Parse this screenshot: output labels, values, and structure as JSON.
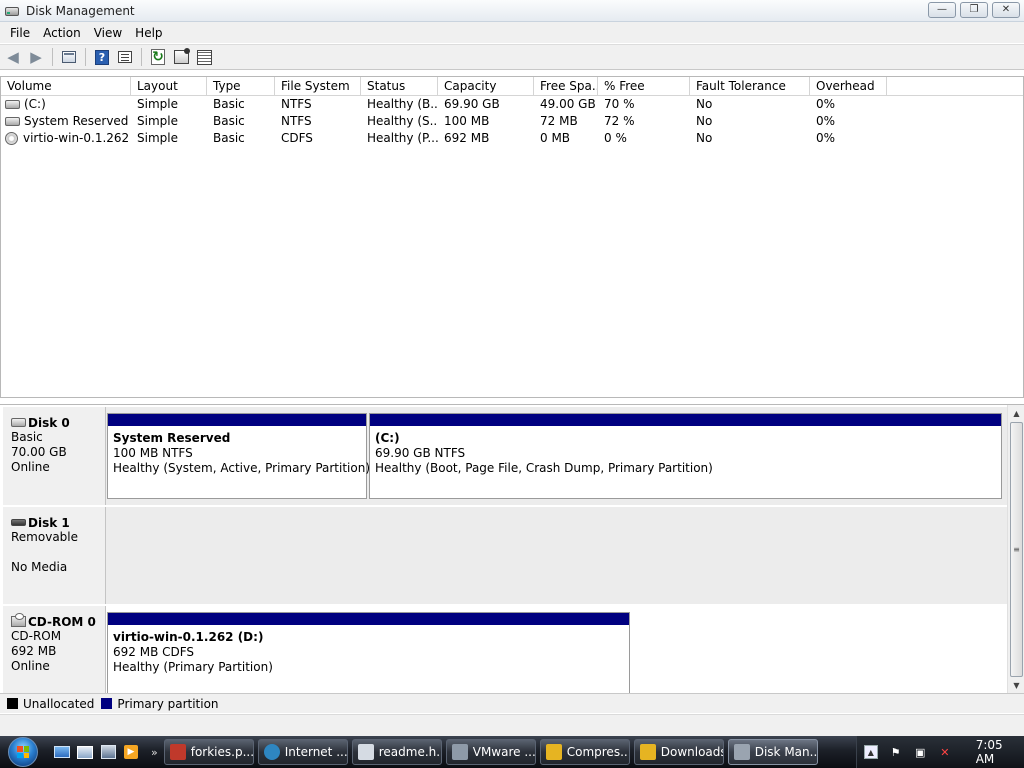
{
  "window": {
    "title": "Disk Management",
    "controls": {
      "minimize": "—",
      "restore": "❐",
      "close": "✕"
    }
  },
  "menu": [
    "File",
    "Action",
    "View",
    "Help"
  ],
  "toolbar": {
    "icons": [
      "back-icon",
      "forward-icon",
      "console-tree-icon",
      "help-icon",
      "list-view-icon",
      "refresh-icon",
      "properties-icon",
      "rescan-disks-icon"
    ],
    "help_glyph": "?"
  },
  "volume_list": {
    "columns": [
      "Volume",
      "Layout",
      "Type",
      "File System",
      "Status",
      "Capacity",
      "Free Spa...",
      "% Free",
      "Fault Tolerance",
      "Overhead"
    ],
    "rows": [
      {
        "volume": "(C:)",
        "layout": "Simple",
        "type": "Basic",
        "fs": "NTFS",
        "status": "Healthy (B...",
        "capacity": "69.90 GB",
        "free": "49.00 GB",
        "pct": "70 %",
        "fault": "No",
        "overhead": "0%",
        "icon": "hard-drive-icon"
      },
      {
        "volume": "System Reserved",
        "layout": "Simple",
        "type": "Basic",
        "fs": "NTFS",
        "status": "Healthy (S...",
        "capacity": "100 MB",
        "free": "72 MB",
        "pct": "72 %",
        "fault": "No",
        "overhead": "0%",
        "icon": "hard-drive-icon"
      },
      {
        "volume": "virtio-win-0.1.262 ...",
        "layout": "Simple",
        "type": "Basic",
        "fs": "CDFS",
        "status": "Healthy (P...",
        "capacity": "692 MB",
        "free": "0 MB",
        "pct": "0 %",
        "fault": "No",
        "overhead": "0%",
        "icon": "cd-drive-icon"
      }
    ]
  },
  "disks": [
    {
      "name": "Disk 0",
      "line1": "Basic",
      "line2": "70.00 GB",
      "line3": "Online",
      "partitions": [
        {
          "title": "System Reserved",
          "size": "100 MB NTFS",
          "status": "Healthy (System, Active, Primary Partition)"
        },
        {
          "title": "(C:)",
          "size": "69.90 GB NTFS",
          "status": "Healthy (Boot, Page File, Crash Dump, Primary Partition)"
        }
      ]
    },
    {
      "name": "Disk 1",
      "line1": "Removable",
      "line2": "",
      "line3": "No Media",
      "partitions": []
    },
    {
      "name": "CD-ROM 0",
      "line1": "CD-ROM",
      "line2": "692 MB",
      "line3": "Online",
      "partitions": [
        {
          "title": "virtio-win-0.1.262  (D:)",
          "size": "692 MB CDFS",
          "status": "Healthy (Primary Partition)"
        }
      ]
    }
  ],
  "legend": [
    {
      "label": "Unallocated",
      "color": "#000000"
    },
    {
      "label": "Primary partition",
      "color": "#000080"
    }
  ],
  "taskbar": {
    "quick_launch_more": "»",
    "buttons": [
      {
        "label": "forkies.p...",
        "color": "#c0392b"
      },
      {
        "label": "Internet ...",
        "color": "#2e86c1"
      },
      {
        "label": "readme.h...",
        "color": "#d5dbe3"
      },
      {
        "label": "VMware ...",
        "color": "#8e9aa8"
      },
      {
        "label": "Compres...",
        "color": "#e6b422"
      },
      {
        "label": "Downloads",
        "color": "#e6b422"
      },
      {
        "label": "Disk Man...",
        "color": "#9aa4b0"
      }
    ],
    "clock": "7:05 AM"
  }
}
